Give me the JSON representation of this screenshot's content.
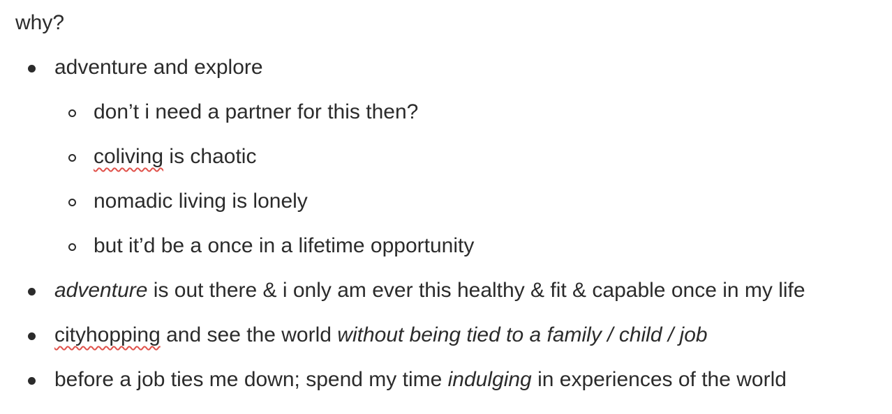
{
  "heading": "why?",
  "items": [
    {
      "level": 1,
      "segments": [
        {
          "text": "adventure and explore",
          "style": "normal"
        }
      ]
    },
    {
      "level": 2,
      "segments": [
        {
          "text": "don’t i need a partner for this then?",
          "style": "normal"
        }
      ]
    },
    {
      "level": 2,
      "segments": [
        {
          "text": "coliving",
          "style": "misspelled"
        },
        {
          "text": " is chaotic",
          "style": "normal"
        }
      ]
    },
    {
      "level": 2,
      "segments": [
        {
          "text": "nomadic living is lonely",
          "style": "normal"
        }
      ]
    },
    {
      "level": 2,
      "segments": [
        {
          "text": "but it’d be a once in a lifetime opportunity",
          "style": "normal"
        }
      ]
    },
    {
      "level": 1,
      "segments": [
        {
          "text": "adventure",
          "style": "italic"
        },
        {
          "text": " is out there & i only am ever this healthy & fit & capable once in my life",
          "style": "normal"
        }
      ]
    },
    {
      "level": 1,
      "segments": [
        {
          "text": "cityhopping",
          "style": "misspelled"
        },
        {
          "text": " and see the world ",
          "style": "normal"
        },
        {
          "text": "without being tied to a family / child / job",
          "style": "italic"
        }
      ]
    },
    {
      "level": 1,
      "segments": [
        {
          "text": "before a job ties me down; spend my time ",
          "style": "normal"
        },
        {
          "text": "indulging",
          "style": "italic"
        },
        {
          "text": " in experiences of the world",
          "style": "normal"
        }
      ]
    }
  ]
}
